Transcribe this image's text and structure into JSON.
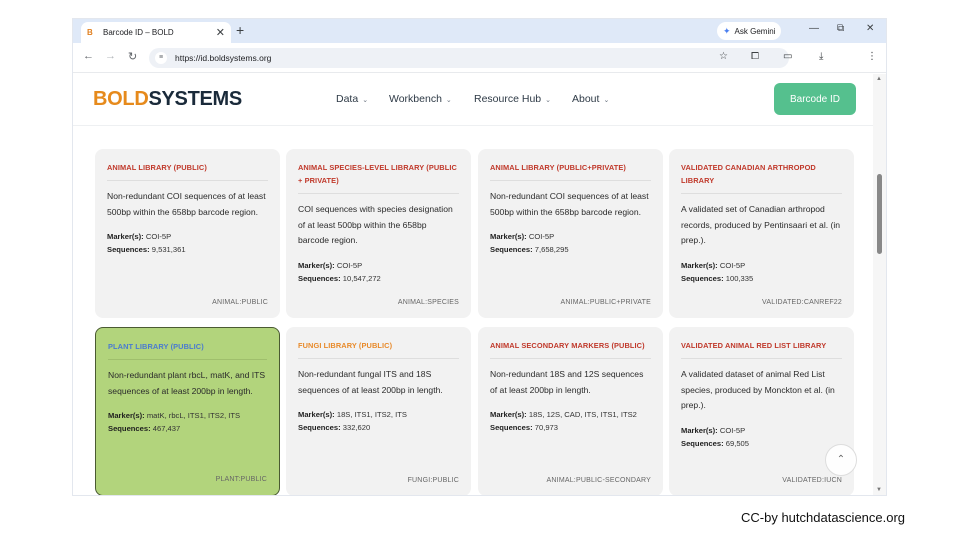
{
  "browser": {
    "tab_title": "Barcode ID – BOLD",
    "tab_favicon": "B",
    "new_tab": "+",
    "tab_close": "✕",
    "gemini_label": "Ask Gemini",
    "url": "https://id.boldsystems.org",
    "minimize": "—",
    "restore": "⧉",
    "close": "✕"
  },
  "site": {
    "logo_bold": "BOLD",
    "logo_systems": "SYSTEMS",
    "nav": [
      {
        "label": "Data"
      },
      {
        "label": "Workbench"
      },
      {
        "label": "Resource Hub"
      },
      {
        "label": "About"
      }
    ],
    "cta_label": "Barcode ID"
  },
  "labels": {
    "markers": "Marker(s):",
    "sequences": "Sequences:"
  },
  "cards": [
    {
      "title": "ANIMAL LIBRARY (PUBLIC)",
      "title_color": "#c0392b",
      "description": "Non-redundant COI sequences of at least 500bp within the 658bp barcode region.",
      "markers": "COI-5P",
      "sequences": "9,531,361",
      "tag": "ANIMAL:PUBLIC"
    },
    {
      "title": "ANIMAL SPECIES-LEVEL LIBRARY (PUBLIC + PRIVATE)",
      "title_color": "#c0392b",
      "description": "COI sequences with species designation of at least 500bp within the 658bp barcode region.",
      "markers": "COI-5P",
      "sequences": "10,547,272",
      "tag": "ANIMAL:SPECIES"
    },
    {
      "title": "ANIMAL LIBRARY (PUBLIC+PRIVATE)",
      "title_color": "#c0392b",
      "description": "Non-redundant COI sequences of at least 500bp within the 658bp barcode region.",
      "markers": "COI-5P",
      "sequences": "7,658,295",
      "tag": "ANIMAL:PUBLIC+PRIVATE"
    },
    {
      "title": "VALIDATED CANADIAN ARTHROPOD LIBRARY",
      "title_color": "#c0392b",
      "description": "A validated set of Canadian arthropod records, produced by Pentinsaari et al. (in prep.).",
      "markers": "COI-5P",
      "sequences": "100,335",
      "tag": "VALIDATED:CANREF22"
    },
    {
      "title": "PLANT LIBRARY (PUBLIC)",
      "title_color": "#4a7bd0",
      "description": "Non-redundant plant rbcL, matK, and ITS sequences of at least 200bp in length.",
      "markers": "matK, rbcL, ITS1, ITS2, ITS",
      "sequences": "467,437",
      "tag": "PLANT:PUBLIC"
    },
    {
      "title": "FUNGI LIBRARY (PUBLIC)",
      "title_color": "#e88a2a",
      "description": "Non-redundant fungal ITS and 18S sequences of at least 200bp in length.",
      "markers": "18S, ITS1, ITS2, ITS",
      "sequences": "332,620",
      "tag": "FUNGI:PUBLIC"
    },
    {
      "title": "ANIMAL SECONDARY MARKERS (PUBLIC)",
      "title_color": "#c0392b",
      "description": "Non-redundant 18S and 12S sequences of at least 200bp in length.",
      "markers": "18S, 12S, CAD, ITS, ITS1, ITS2",
      "sequences": "70,973",
      "tag": "ANIMAL:PUBLIC-SECONDARY"
    },
    {
      "title": "VALIDATED ANIMAL RED LIST LIBRARY",
      "title_color": "#c0392b",
      "description": "A validated dataset of animal Red List species, produced by Monckton et al. (in prep.).",
      "markers": "COI-5P",
      "sequences": "69,505",
      "tag": "VALIDATED:IUCN"
    }
  ],
  "credit": "CC-by hutchdatascience.org",
  "colors": {
    "accent_green": "#55c08e",
    "selected_card": "#b2d47c",
    "logo_orange": "#e68a1c"
  }
}
